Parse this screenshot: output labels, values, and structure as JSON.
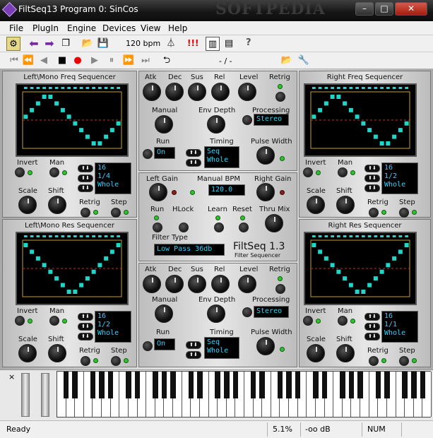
{
  "window": {
    "title": "FiltSeq13 Program 0: SinCos",
    "watermark": "SOFTPEDIA"
  },
  "menu": [
    "File",
    "PlugIn",
    "Engine",
    "Devices",
    "View",
    "Help"
  ],
  "toolbar": {
    "bpm": "120 bpm",
    "alert": "!!!",
    "help": "?"
  },
  "transport": {
    "position": "- / -"
  },
  "sequencers": {
    "left_freq": {
      "title": "Left\\Mono Freq Sequencer",
      "invert": "Invert",
      "man": "Man",
      "scale": "Scale",
      "shift": "Shift",
      "retrig": "Retrig",
      "step": "Step",
      "lcd": [
        "16",
        "1/4",
        "Whole"
      ],
      "steps": [
        4,
        3,
        2,
        1,
        1,
        2,
        3,
        4,
        5,
        6,
        7,
        8,
        8,
        7,
        6,
        5
      ]
    },
    "left_res": {
      "title": "Left\\Mono Res Sequencer",
      "invert": "Invert",
      "man": "Man",
      "scale": "Scale",
      "shift": "Shift",
      "retrig": "Retrig",
      "step": "Step",
      "lcd": [
        "16",
        "1/2",
        "Whole"
      ],
      "steps": [
        1,
        2,
        3,
        4,
        5,
        6,
        7,
        8,
        8,
        7,
        6,
        5,
        4,
        3,
        2,
        1
      ]
    },
    "right_freq": {
      "title": "Right Freq Sequencer",
      "invert": "Invert",
      "man": "Man",
      "scale": "Scale",
      "shift": "Shift",
      "retrig": "Retrig",
      "step": "Step",
      "lcd": [
        "16",
        "1/2",
        "Whole"
      ],
      "steps": [
        4,
        3,
        2,
        1,
        1,
        2,
        3,
        4,
        5,
        6,
        7,
        8,
        8,
        7,
        6,
        5
      ]
    },
    "right_res": {
      "title": "Right Res Sequencer",
      "invert": "Invert",
      "man": "Man",
      "scale": "Scale",
      "shift": "Shift",
      "retrig": "Retrig",
      "step": "Step",
      "lcd": [
        "16",
        "1/1",
        "Whole"
      ],
      "steps": [
        1,
        2,
        3,
        4,
        5,
        6,
        7,
        8,
        8,
        7,
        6,
        5,
        4,
        3,
        2,
        1
      ]
    }
  },
  "env_top": {
    "atk": "Atk",
    "dec": "Dec",
    "sus": "Sus",
    "rel": "Rel",
    "level": "Level",
    "retrig": "Retrig",
    "manual": "Manual",
    "env_depth": "Env Depth",
    "processing": "Processing",
    "processing_value": "Stereo",
    "run": "Run",
    "run_value": "On",
    "timing": "Timing",
    "timing_values": [
      "Seq",
      "Whole"
    ],
    "pulse_width": "Pulse Width"
  },
  "env_bottom": {
    "atk": "Atk",
    "dec": "Dec",
    "sus": "Sus",
    "rel": "Rel",
    "level": "Level",
    "retrig": "Retrig",
    "manual": "Manual",
    "env_depth": "Env Depth",
    "processing": "Processing",
    "processing_value": "Stereo",
    "run": "Run",
    "run_value": "On",
    "timing": "Timing",
    "timing_values": [
      "Seq",
      "Whole"
    ],
    "pulse_width": "Pulse Width"
  },
  "center": {
    "left_gain": "Left Gain",
    "manual_bpm": "Manual BPM",
    "bpm_value": "120.0",
    "right_gain": "Right Gain",
    "run": "Run",
    "hlock": "HLock",
    "learn": "Learn",
    "reset": "Reset",
    "thru_mix": "Thru Mix",
    "filter_type": "Filter Type",
    "filter_value": "Low Pass 36db",
    "product": "FiltSeq 1.3",
    "product_sub": "Filter Sequencer"
  },
  "status": {
    "ready": "Ready",
    "cpu": "5.1%",
    "level": "-oo dB",
    "num": "NUM"
  },
  "colors": {
    "accent": "#2fd3ff",
    "step": "#1fd6c9",
    "led": "#2ec42e"
  }
}
